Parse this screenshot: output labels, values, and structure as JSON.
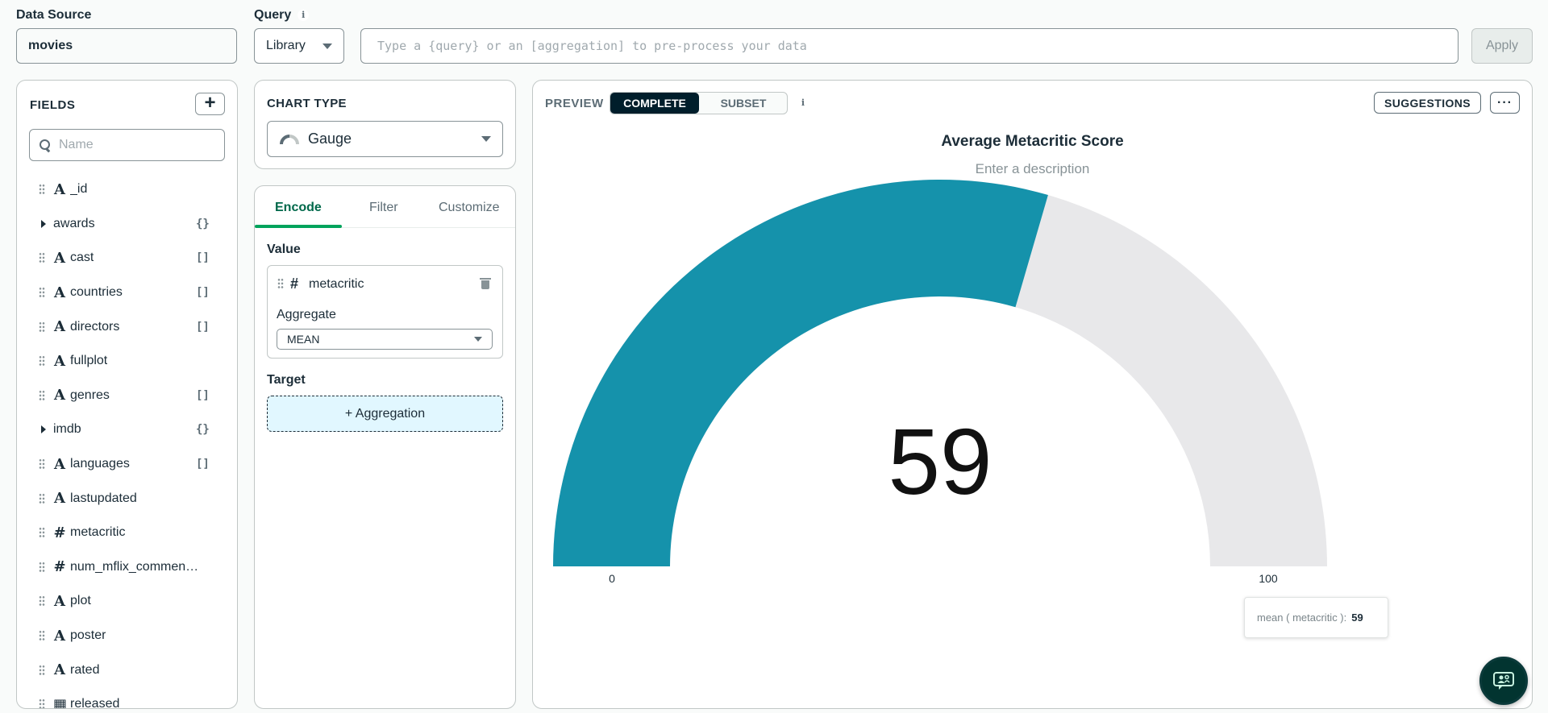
{
  "data_source": {
    "label": "Data Source",
    "value": "movies"
  },
  "query": {
    "label": "Query",
    "library_label": "Library",
    "placeholder": "Type a {query} or an [aggregation] to pre-process your data",
    "apply_label": "Apply"
  },
  "fields": {
    "title": "FIELDS",
    "add_label": "+",
    "search_placeholder": "Name",
    "items": [
      {
        "name": "_id",
        "type": "string",
        "badge": ""
      },
      {
        "name": "awards",
        "type": "object",
        "badge": "{}"
      },
      {
        "name": "cast",
        "type": "string",
        "badge": "[]"
      },
      {
        "name": "countries",
        "type": "string",
        "badge": "[]"
      },
      {
        "name": "directors",
        "type": "string",
        "badge": "[]"
      },
      {
        "name": "fullplot",
        "type": "string",
        "badge": ""
      },
      {
        "name": "genres",
        "type": "string",
        "badge": "[]"
      },
      {
        "name": "imdb",
        "type": "object",
        "badge": "{}"
      },
      {
        "name": "languages",
        "type": "string",
        "badge": "[]"
      },
      {
        "name": "lastupdated",
        "type": "string",
        "badge": ""
      },
      {
        "name": "metacritic",
        "type": "number",
        "badge": ""
      },
      {
        "name": "num_mflix_commen…",
        "type": "number",
        "badge": ""
      },
      {
        "name": "plot",
        "type": "string",
        "badge": ""
      },
      {
        "name": "poster",
        "type": "string",
        "badge": ""
      },
      {
        "name": "rated",
        "type": "string",
        "badge": ""
      },
      {
        "name": "released",
        "type": "date",
        "badge": ""
      }
    ]
  },
  "chart_type": {
    "title": "CHART TYPE",
    "value": "Gauge"
  },
  "encode": {
    "tabs": [
      "Encode",
      "Filter",
      "Customize"
    ],
    "value_label": "Value",
    "value_field": "metacritic",
    "value_field_icon": "#",
    "aggregate_label": "Aggregate",
    "aggregate_value": "MEAN",
    "target_label": "Target",
    "target_add": "+ Aggregation"
  },
  "preview": {
    "label": "PREVIEW",
    "modes": [
      "COMPLETE",
      "SUBSET"
    ],
    "active_mode": "COMPLETE",
    "suggestions_label": "SUGGESTIONS",
    "more_label": "···",
    "title": "Average Metacritic Score",
    "description_placeholder": "Enter a description"
  },
  "chart_data": {
    "type": "gauge",
    "title": "Average Metacritic Score",
    "value": 59,
    "value_label": "59",
    "min": 0,
    "max": 100,
    "min_label": "0",
    "max_label": "100",
    "fill_color": "#1592ab",
    "track_color": "#e8e8ea",
    "tooltip": {
      "label": "mean ( metacritic ):",
      "value": "59"
    }
  },
  "icons": {
    "info": "info-icon",
    "search": "search-icon",
    "gauge": "gauge-icon",
    "chat": "chat-support-icon"
  }
}
